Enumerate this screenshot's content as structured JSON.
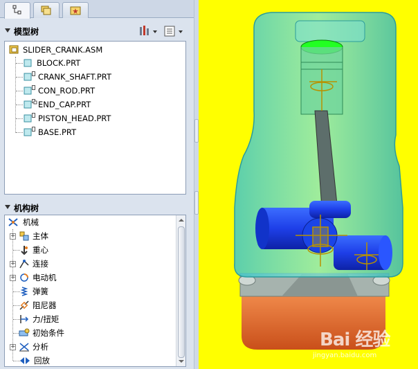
{
  "model_tree": {
    "title": "模型树",
    "items": [
      {
        "label": "SLIDER_CRANK.ASM"
      },
      {
        "label": "BLOCK.PRT"
      },
      {
        "label": "CRANK_SHAFT.PRT"
      },
      {
        "label": "CON_ROD.PRT"
      },
      {
        "label": "END_CAP.PRT"
      },
      {
        "label": "PISTON_HEAD.PRT"
      },
      {
        "label": "BASE.PRT"
      }
    ]
  },
  "mechanism_tree": {
    "title": "机构树",
    "root": "机械",
    "items": [
      {
        "label": "主体"
      },
      {
        "label": "重心"
      },
      {
        "label": "连接"
      },
      {
        "label": "电动机"
      },
      {
        "label": "弹簧"
      },
      {
        "label": "阻尼器"
      },
      {
        "label": "力/扭矩"
      },
      {
        "label": "初始条件"
      },
      {
        "label": "分析"
      },
      {
        "label": "回放"
      }
    ]
  },
  "watermark": {
    "main": "Bai 经验",
    "sub": "jingyan.baidu.com"
  },
  "colors": {
    "viewport_bg": "#ffff00",
    "housing": "#55d8c6",
    "shaft": "#1e4dff",
    "base": "#e8662a",
    "piston": "#22ff22"
  }
}
